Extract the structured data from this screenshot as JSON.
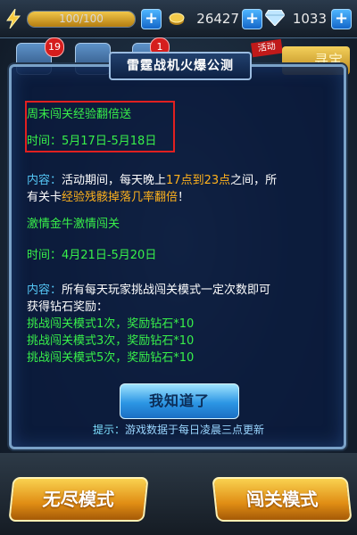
{
  "top_bar": {
    "energy": {
      "text": "100/100",
      "fraction": 1.0
    },
    "coins": "26427",
    "gems": "1033"
  },
  "background": {
    "mail_badge": "19",
    "mission_badge": "1",
    "event_tag": "活动",
    "gold_button_partial": "寻宝"
  },
  "dialog": {
    "title": "雷霆战机火爆公测",
    "event1": {
      "name": "周末闯关经验翻倍送",
      "time_label": "时间：",
      "time_value": "5月17日-5月18日"
    },
    "content1": {
      "label": "内容：",
      "line1_a": "活动期间，每天晚上",
      "line1_b": "17点到23点",
      "line1_c": "之间，所",
      "line2_a": "有关卡",
      "line2_b": "经验残骸掉落几率翻倍",
      "line2_c": "！"
    },
    "event2": {
      "name": "激情金牛激情闯关",
      "time_label": "时间：",
      "time_value": "4月21日-5月20日"
    },
    "content2": {
      "label": "内容：",
      "line1": "所有每天玩家挑战闯关模式一定次数即可",
      "line2": "获得钻石奖励：",
      "rewards": [
        "挑战闯关模式1次，奖励钻石*10",
        "挑战闯关模式3次，奖励钻石*10",
        "挑战闯关模式5次，奖励钻石*10"
      ]
    },
    "ok_button": "我知道了",
    "tip_label": "提示：",
    "tip_text": "游戏数据于每日凌晨三点更新"
  },
  "bottom": {
    "endless_mode": "无尽模式",
    "stage_mode": "闯关模式"
  },
  "colors": {
    "green": "#38f04a",
    "cyan": "#54c6f5",
    "orange": "#ffb21c",
    "highlight_red": "#e02020"
  }
}
